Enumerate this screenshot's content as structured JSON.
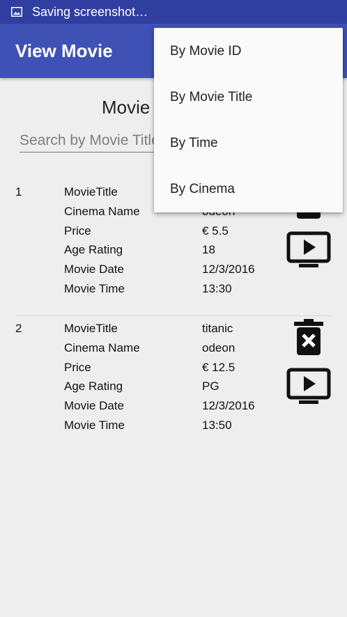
{
  "status_bar": {
    "text": "Saving screenshot…",
    "icon": "image-icon"
  },
  "app_bar": {
    "title": "View Movie"
  },
  "heading": "Movie",
  "search": {
    "placeholder": "Search by Movie Title",
    "value": ""
  },
  "labels": [
    "MovieTitle",
    "Cinema Name",
    "Price",
    "Age Rating",
    "Movie Date",
    "Movie Time"
  ],
  "movies": [
    {
      "num": "1",
      "title": "",
      "cinema": "odeon",
      "price": "€ 5.5",
      "age": "18",
      "date": "12/3/2016",
      "time": "13:30"
    },
    {
      "num": "2",
      "title": "titanic",
      "cinema": "odeon",
      "price": "€ 12.5",
      "age": "PG",
      "date": "12/3/2016",
      "time": "13:50"
    }
  ],
  "menu": {
    "items": [
      "By Movie ID",
      "By Movie Title",
      "By Time",
      "By Cinema"
    ]
  },
  "icons": {
    "delete": "delete-icon",
    "play": "play-icon"
  }
}
